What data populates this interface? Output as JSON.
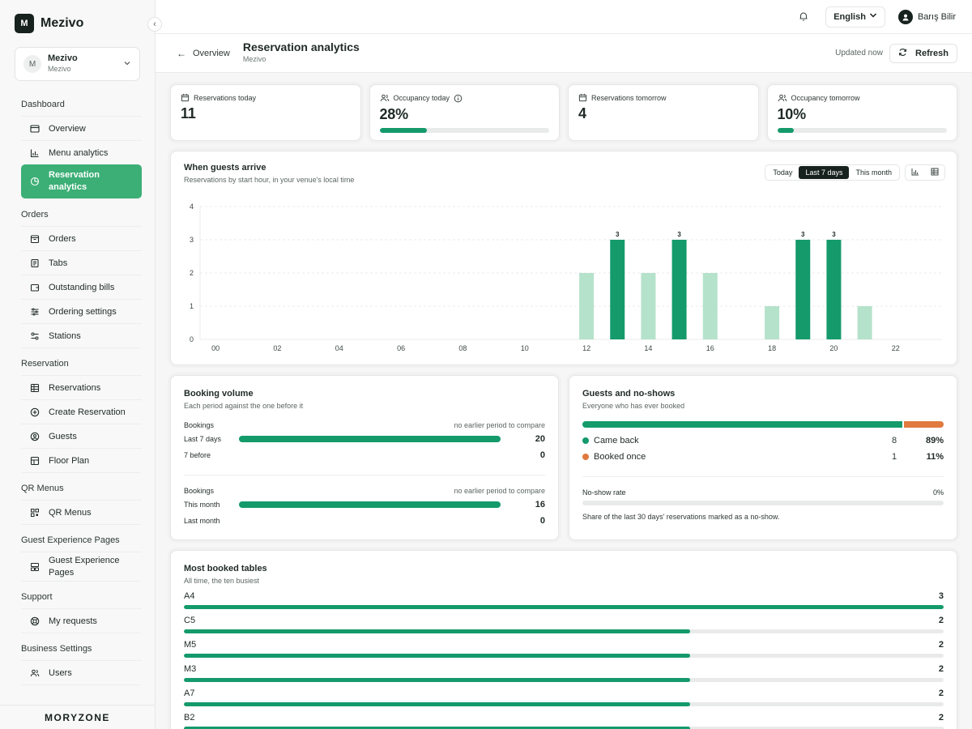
{
  "brand": {
    "logo_letter": "M",
    "name": "Mezivo"
  },
  "venue": {
    "avatar": "M",
    "name": "Mezivo",
    "sub": "Mezivo"
  },
  "sidebar": {
    "sections": [
      {
        "title": "Dashboard",
        "items": [
          {
            "label": "Overview",
            "icon": "overview-icon"
          },
          {
            "label": "Menu analytics",
            "icon": "bar-chart-icon"
          },
          {
            "label": "Reservation analytics",
            "icon": "pie-chart-icon",
            "active": true
          }
        ]
      },
      {
        "title": "Orders",
        "items": [
          {
            "label": "Orders",
            "icon": "orders-icon"
          },
          {
            "label": "Tabs",
            "icon": "receipt-icon"
          },
          {
            "label": "Outstanding bills",
            "icon": "wallet-icon"
          },
          {
            "label": "Ordering settings",
            "icon": "sliders-icon"
          },
          {
            "label": "Stations",
            "icon": "stations-icon"
          }
        ]
      },
      {
        "title": "Reservation",
        "items": [
          {
            "label": "Reservations",
            "icon": "table-icon"
          },
          {
            "label": "Create Reservation",
            "icon": "plus-circle-icon"
          },
          {
            "label": "Guests",
            "icon": "user-circle-icon"
          },
          {
            "label": "Floor Plan",
            "icon": "floor-plan-icon"
          }
        ]
      },
      {
        "title": "QR Menus",
        "items": [
          {
            "label": "QR Menus",
            "icon": "qr-icon"
          }
        ]
      },
      {
        "title": "Guest Experience Pages",
        "items": [
          {
            "label": "Guest Experience Pages",
            "icon": "layout-icon"
          }
        ]
      },
      {
        "title": "Support",
        "items": [
          {
            "label": "My requests",
            "icon": "lifebuoy-icon"
          }
        ]
      },
      {
        "title": "Business Settings",
        "items": [
          {
            "label": "Users",
            "icon": "users-icon"
          }
        ]
      }
    ],
    "footer": "MORYZONE"
  },
  "topbar": {
    "language": "English",
    "user": "Barış Bilir"
  },
  "page": {
    "back_label": "Overview",
    "title": "Reservation analytics",
    "subtitle": "Mezivo",
    "updated": "Updated now",
    "refresh_label": "Refresh"
  },
  "kpis": [
    {
      "label": "Reservations today",
      "value": "11",
      "icon": "calendar-icon"
    },
    {
      "label": "Occupancy today",
      "value": "28%",
      "icon": "users-icon",
      "info": true,
      "progress": 0.28
    },
    {
      "label": "Reservations tomorrow",
      "value": "4",
      "icon": "calendar-icon"
    },
    {
      "label": "Occupancy tomorrow",
      "value": "10%",
      "icon": "users-icon",
      "progress": 0.1
    }
  ],
  "arrivals": {
    "title": "When guests arrive",
    "subtitle": "Reservations by start hour, in your venue's local time",
    "ranges": [
      "Today",
      "Last 7 days",
      "This month"
    ],
    "selected_range": "Last 7 days",
    "colors": {
      "dark": "#149a6b",
      "light": "#b5e2cb",
      "grid": "#e8ebe9"
    }
  },
  "chart_data": {
    "type": "bar",
    "x_ticks": [
      "00",
      "02",
      "04",
      "06",
      "08",
      "10",
      "12",
      "14",
      "16",
      "18",
      "20",
      "22"
    ],
    "y_ticks": [
      0,
      1,
      2,
      3,
      4
    ],
    "ylim": [
      0,
      4
    ],
    "x": [
      12,
      13,
      14,
      15,
      16,
      18,
      19,
      20,
      21
    ],
    "values": [
      2,
      3,
      2,
      3,
      2,
      1,
      3,
      3,
      1
    ],
    "labeled": [
      false,
      true,
      false,
      true,
      false,
      false,
      true,
      true,
      false
    ],
    "grid": true
  },
  "volume": {
    "title": "Booking volume",
    "subtitle": "Each period against the one before it",
    "groups": [
      {
        "head": "Bookings",
        "note": "no earlier period to compare",
        "rows": [
          {
            "label": "Last 7 days",
            "value": "20",
            "fill": 1.0
          },
          {
            "label": "7 before",
            "value": "0",
            "fill": 0
          }
        ]
      },
      {
        "head": "Bookings",
        "note": "no earlier period to compare",
        "rows": [
          {
            "label": "This month",
            "value": "16",
            "fill": 1.0
          },
          {
            "label": "Last month",
            "value": "0",
            "fill": 0
          }
        ]
      }
    ]
  },
  "guests": {
    "title": "Guests and no-shows",
    "subtitle": "Everyone who has ever booked",
    "items": [
      {
        "label": "Came back",
        "count": "8",
        "pct": "89%",
        "share": 0.89,
        "color": "#149a6b"
      },
      {
        "label": "Booked once",
        "count": "1",
        "pct": "11%",
        "share": 0.11,
        "color": "#e07a3f"
      }
    ],
    "noshow_label": "No-show rate",
    "noshow_value": "0%",
    "noshow_note": "Share of the last 30 days' reservations marked as a no-show."
  },
  "tables": {
    "title": "Most booked tables",
    "subtitle": "All time, the ten busiest",
    "rows": [
      {
        "name": "A4",
        "value": "3",
        "fill": 1.0
      },
      {
        "name": "C5",
        "value": "2",
        "fill": 0.6667
      },
      {
        "name": "M5",
        "value": "2",
        "fill": 0.6667
      },
      {
        "name": "M3",
        "value": "2",
        "fill": 0.6667
      },
      {
        "name": "A7",
        "value": "2",
        "fill": 0.6667
      },
      {
        "name": "B2",
        "value": "2",
        "fill": 0.6667
      }
    ]
  }
}
